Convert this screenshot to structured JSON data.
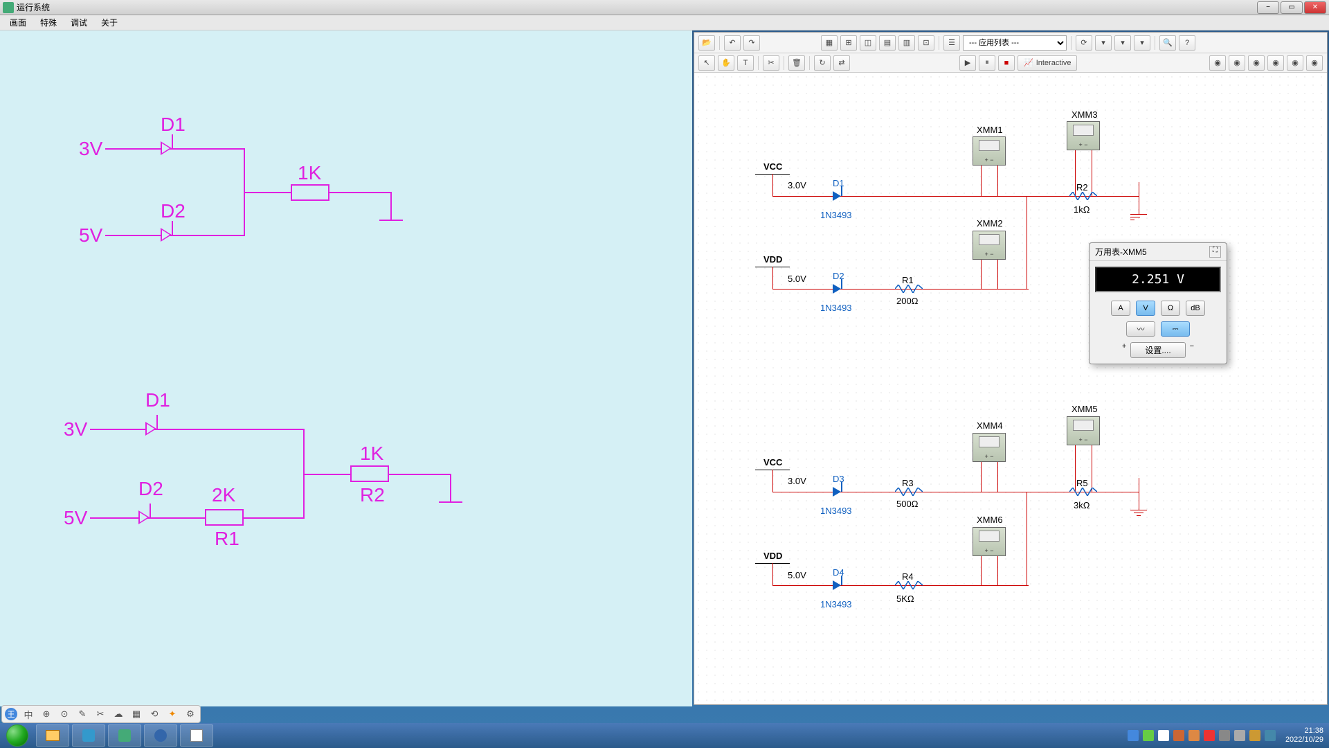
{
  "window": {
    "title": "运行系统",
    "menu": [
      "画面",
      "特殊",
      "调试",
      "关于"
    ]
  },
  "left_circuits": {
    "c1": {
      "v1": "3V",
      "v2": "5V",
      "d1": "D1",
      "d2": "D2",
      "r": "1K"
    },
    "c2": {
      "v1": "3V",
      "v2": "5V",
      "d1": "D1",
      "d2": "D2",
      "r1_label": "2K",
      "r1_name": "R1",
      "r2_label": "1K",
      "r2_name": "R2"
    }
  },
  "right_toolbar": {
    "dropdown": "--- 应用列表 ---",
    "sim_mode": "Interactive"
  },
  "schematic": {
    "ckt1": {
      "vcc": "VCC",
      "vcc_val": "3.0V",
      "d1": "D1",
      "d1_model": "1N3493",
      "vdd": "VDD",
      "vdd_val": "5.0V",
      "d2": "D2",
      "d2_model": "1N3493",
      "r1": "R1",
      "r1_val": "200Ω",
      "r2": "R2",
      "r2_val": "1kΩ",
      "xmm1": "XMM1",
      "xmm2": "XMM2",
      "xmm3": "XMM3"
    },
    "ckt2": {
      "vcc": "VCC",
      "vcc_val": "3.0V",
      "d3": "D3",
      "d3_model": "1N3493",
      "vdd": "VDD",
      "vdd_val": "5.0V",
      "d4": "D4",
      "d4_model": "1N3493",
      "r3": "R3",
      "r3_val": "500Ω",
      "r4": "R4",
      "r4_val": "5KΩ",
      "r5": "R5",
      "r5_val": "3kΩ",
      "xmm4": "XMM4",
      "xmm5": "XMM5",
      "xmm6": "XMM6"
    }
  },
  "multimeter": {
    "title": "万用表-XMM5",
    "reading": "2.251 V",
    "btns": {
      "a": "A",
      "v": "V",
      "ohm": "Ω",
      "db": "dB"
    },
    "settings": "设置...."
  },
  "bottom_tools": [
    "中",
    "⊕",
    "⊙",
    "✎",
    "✂",
    "☁",
    "▦",
    "⟲",
    "✦",
    "⚙"
  ],
  "taskbar": {
    "time": "21:38",
    "date": "2022/10/29"
  }
}
